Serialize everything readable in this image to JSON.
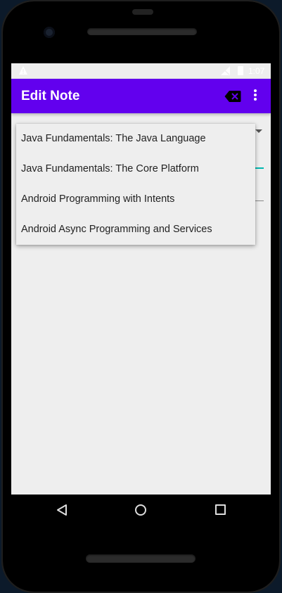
{
  "status_bar": {
    "time": "1:07",
    "alert_icon": "warning-icon",
    "signal_icon": "no-signal-icon",
    "battery_icon": "battery-icon"
  },
  "app_bar": {
    "title": "Edit Note",
    "background_color": "#6200ee",
    "actions": [
      {
        "icon": "backspace-icon"
      },
      {
        "icon": "more-vert-icon"
      }
    ]
  },
  "course_dropdown": {
    "items": [
      "Java Fundamentals: The Java Language",
      "Java Fundamentals: The Core Platform",
      "Android Programming with Intents",
      "Android Async Programming and Services"
    ]
  },
  "nav_bar": {
    "buttons": [
      "back-icon",
      "home-icon",
      "recents-icon"
    ]
  }
}
